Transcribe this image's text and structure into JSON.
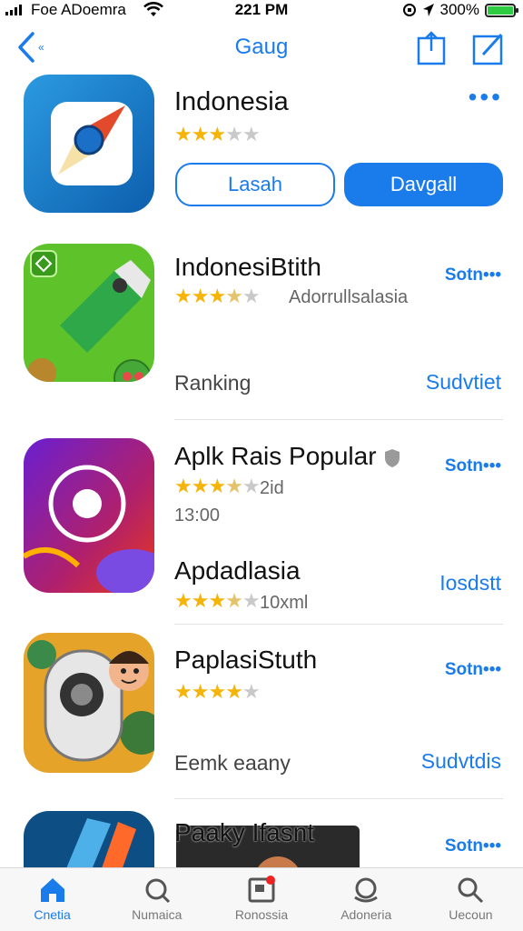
{
  "status_bar": {
    "carrier": "Foe ADoemra",
    "time": "221 PM",
    "battery": "300%"
  },
  "nav": {
    "back_label": "«",
    "title": "Gaug"
  },
  "featured": {
    "name": "Indonesia",
    "rating": 3,
    "more": "•••",
    "secondary_button": "Lasah",
    "primary_button": "Davgall"
  },
  "list": [
    {
      "title": "IndonesiBtith",
      "rating": 3.5,
      "developer": "Adorrullsalasia",
      "get": "Sotn•••",
      "detail": "Ranking",
      "link": "Sudvtiet"
    },
    {
      "title": "Aplk Rais Popular",
      "rating": 3.5,
      "count": "2id",
      "time": "13:00",
      "get": "Sotn•••",
      "detail_title": "Apdadlasia",
      "detail_rating": 3.5,
      "detail_count": "10хml",
      "link": "Iosdstt"
    },
    {
      "title": "PaplasiStuth",
      "rating": 4,
      "get": "Sotn•••",
      "detail": "Eemk eaany",
      "link": "Sudvtdis"
    },
    {
      "title": "Paaky Ifasnt",
      "get": "Sotn•••"
    }
  ],
  "tabs": [
    {
      "label": "Cnetia",
      "icon": "home-icon",
      "active": true
    },
    {
      "label": "Numaica",
      "icon": "refresh-search-icon",
      "active": false
    },
    {
      "label": "Ronossia",
      "icon": "notification-box-icon",
      "active": false
    },
    {
      "label": "Adoneria",
      "icon": "layers-icon",
      "active": false
    },
    {
      "label": "Uecoun",
      "icon": "search-icon",
      "active": false
    }
  ],
  "colors": {
    "accent": "#1a7bea",
    "star": "#f5b40a",
    "star_empty": "#c9c9c9"
  }
}
